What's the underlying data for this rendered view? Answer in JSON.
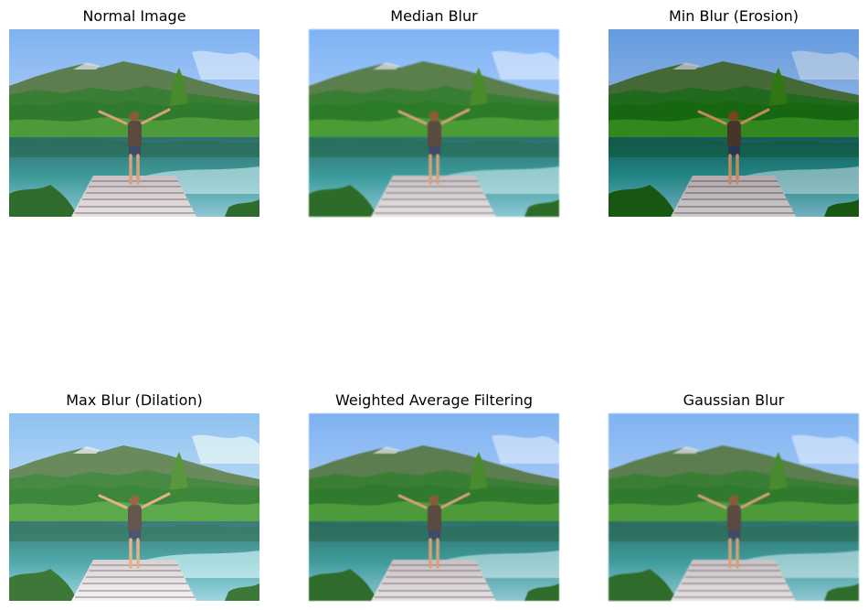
{
  "figure": {
    "panels": [
      {
        "title": "Normal Image",
        "variant": "normal"
      },
      {
        "title": "Median Blur",
        "variant": "median"
      },
      {
        "title": "Min Blur (Erosion)",
        "variant": "min"
      },
      {
        "title": "Max Blur (Dilation)",
        "variant": "max"
      },
      {
        "title": "Weighted Average Filtering",
        "variant": "weighted"
      },
      {
        "title": "Gaussian Blur",
        "variant": "gaussian"
      }
    ]
  },
  "scene_colors": {
    "sky_top": "#7fb2f2",
    "sky_bottom": "#dbe8fa",
    "mountain": "#5c7d4f",
    "forest": "#2f7a2c",
    "water": "#3f9b9a",
    "dock": "#d8d3d4",
    "figure_skin": "#d9a07a",
    "backpack": "#5a4a3f"
  }
}
